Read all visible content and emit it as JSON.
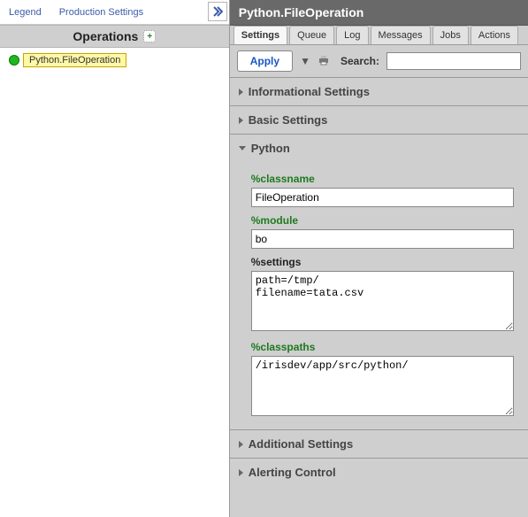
{
  "left": {
    "links": {
      "legend": "Legend",
      "prod": "Production Settings"
    },
    "ops_header": "Operations",
    "tree_item": "Python.FileOperation"
  },
  "header": {
    "title": "Python.FileOperation"
  },
  "tabs": [
    "Settings",
    "Queue",
    "Log",
    "Messages",
    "Jobs",
    "Actions"
  ],
  "toolbar": {
    "apply": "Apply",
    "search_label": "Search:",
    "search_value": ""
  },
  "sections": {
    "info": "Informational Settings",
    "basic": "Basic Settings",
    "python": "Python",
    "additional": "Additional Settings",
    "alerting": "Alerting Control"
  },
  "python": {
    "classname_lbl": "%classname",
    "classname_val": "FileOperation",
    "module_lbl": "%module",
    "module_val": "bo",
    "settings_lbl": "%settings",
    "settings_val": "path=/tmp/\nfilename=tata.csv",
    "classpaths_lbl": "%classpaths",
    "classpaths_val": "/irisdev/app/src/python/"
  }
}
